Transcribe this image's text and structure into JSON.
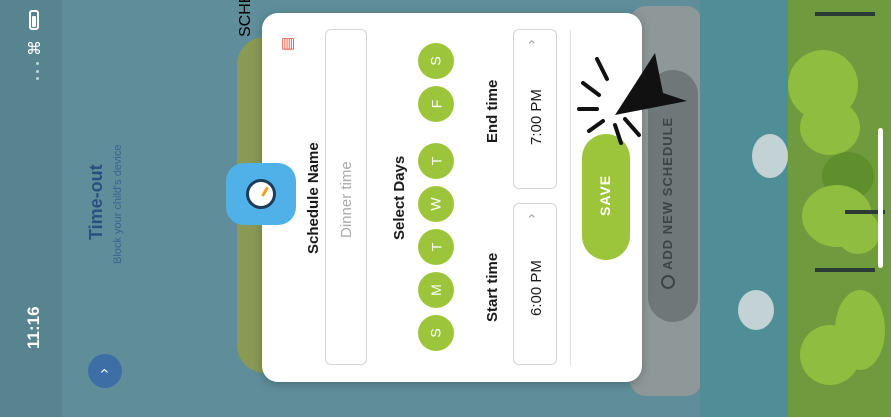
{
  "status_bar": {
    "time": "11:16"
  },
  "header": {
    "title": "Time-out",
    "subtitle": "Block your child's device"
  },
  "background": {
    "schedule_label": "SCHEDULE",
    "add_schedule_label": "ADD NEW SCHEDULE"
  },
  "modal": {
    "schedule_name_label": "Schedule Name",
    "schedule_name_placeholder": "Dinner time",
    "select_days_label": "Select Days",
    "days": [
      "S",
      "M",
      "T",
      "W",
      "T",
      "F",
      "S"
    ],
    "start_time_label": "Start time",
    "start_time_value": "6:00 PM",
    "end_time_label": "End time",
    "end_time_value": "7:00 PM",
    "save_label": "SAVE"
  },
  "icons": {
    "timer": "timer-icon",
    "delete": "trash-icon",
    "chevron": "chevron-right-icon",
    "down": "chevron-down-icon",
    "pointer": "pointer-arrow-icon"
  },
  "colors": {
    "accent_green": "#9dc53b",
    "accent_blue": "#4fb1e8",
    "delete_red": "#e04a3a",
    "header_blue": "#2c4f80"
  }
}
